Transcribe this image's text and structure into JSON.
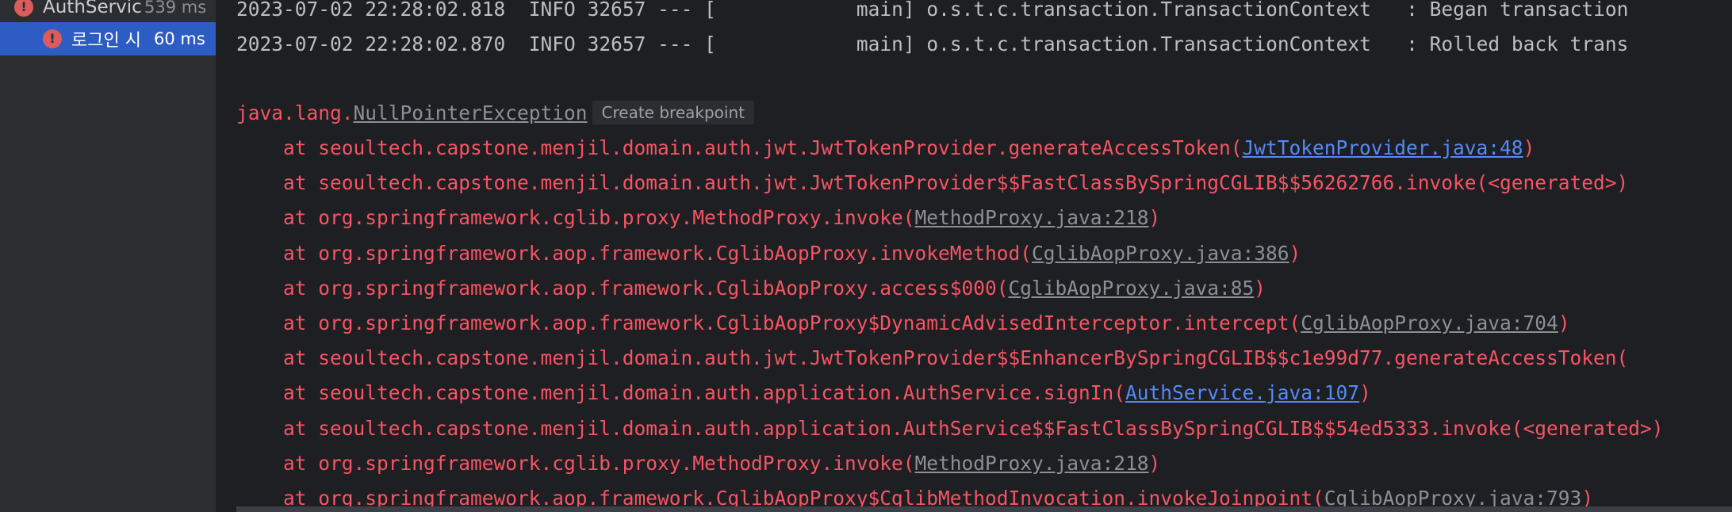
{
  "test_tree": {
    "items": [
      {
        "name": "AuthService",
        "time": "539 ms",
        "status": "failed"
      },
      {
        "name": "로그인 시",
        "time": "60 ms",
        "status": "failed",
        "selected": true
      }
    ]
  },
  "console": {
    "log_lines": [
      {
        "timestamp": "2023-07-02 22:28:02.818",
        "level": "INFO",
        "pid": "32657",
        "thread": "            main]",
        "logger": "o.s.t.c.transaction.TransactionContext",
        "message": ": Began transaction"
      },
      {
        "timestamp": "2023-07-02 22:28:02.870",
        "level": "INFO",
        "pid": "32657",
        "thread": "            main]",
        "logger": "o.s.t.c.transaction.TransactionContext",
        "message": ": Rolled back trans"
      }
    ],
    "exception": {
      "prefix": "java.lang.",
      "name": "NullPointerException",
      "hint": "Create breakpoint"
    },
    "stack_frames": [
      {
        "method": "seoultech.capstone.menjil.domain.auth.jwt.JwtTokenProvider.generateAccessToken(",
        "link": "JwtTokenProvider.java:48",
        "own_source": true,
        "suffix": ")"
      },
      {
        "method": "seoultech.capstone.menjil.domain.auth.jwt.JwtTokenProvider$$FastClassBySpringCGLIB$$56262766.invoke(<generated>)",
        "link": "",
        "own_source": false,
        "suffix": ""
      },
      {
        "method": "org.springframework.cglib.proxy.MethodProxy.invoke(",
        "link": "MethodProxy.java:218",
        "own_source": false,
        "suffix": ")"
      },
      {
        "method": "org.springframework.aop.framework.CglibAopProxy.invokeMethod(",
        "link": "CglibAopProxy.java:386",
        "own_source": false,
        "suffix": ")"
      },
      {
        "method": "org.springframework.aop.framework.CglibAopProxy.access$000(",
        "link": "CglibAopProxy.java:85",
        "own_source": false,
        "suffix": ")"
      },
      {
        "method": "org.springframework.aop.framework.CglibAopProxy$DynamicAdvisedInterceptor.intercept(",
        "link": "CglibAopProxy.java:704",
        "own_source": false,
        "suffix": ")"
      },
      {
        "method": "seoultech.capstone.menjil.domain.auth.jwt.JwtTokenProvider$$EnhancerBySpringCGLIB$$c1e99d77.generateAccessToken(",
        "link": "",
        "own_source": false,
        "suffix": ""
      },
      {
        "method": "seoultech.capstone.menjil.domain.auth.application.AuthService.signIn(",
        "link": "AuthService.java:107",
        "own_source": true,
        "suffix": ")"
      },
      {
        "method": "seoultech.capstone.menjil.domain.auth.application.AuthService$$FastClassBySpringCGLIB$$54ed5333.invoke(<generated>)",
        "link": "",
        "own_source": false,
        "suffix": ""
      },
      {
        "method": "org.springframework.cglib.proxy.MethodProxy.invoke(",
        "link": "MethodProxy.java:218",
        "own_source": false,
        "suffix": ")"
      },
      {
        "method": "org.springframework.aop.framework.CglibAopProxy$CglibMethodInvocation.invokeJoinpoint(",
        "link": "CglibAopProxy.java:793",
        "own_source": false,
        "suffix": ")"
      }
    ],
    "frame_prefix": "    at "
  },
  "colors": {
    "background": "#1e1f22",
    "tree_background": "#2b2d30",
    "selection": "#2e5cc5",
    "error_text": "#f75464",
    "log_text": "#bcbec4",
    "source_link": "#548af7",
    "library_link": "#8c8f96"
  },
  "icons": {
    "test_status": "error-circle-icon"
  }
}
